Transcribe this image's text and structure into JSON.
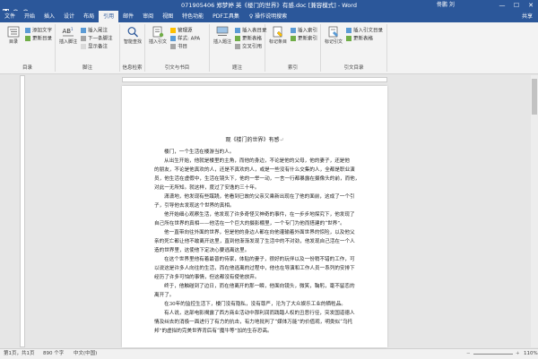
{
  "window": {
    "title": "071905406 郑梦婷 英《楼门的世界》有感.doc [兼容模式] - Word",
    "user": "佟鹏 刘",
    "controls": [
      "—",
      "☐",
      "✕"
    ]
  },
  "tabs": [
    {
      "label": "文件",
      "active": false
    },
    {
      "label": "开始",
      "active": false
    },
    {
      "label": "插入",
      "active": false
    },
    {
      "label": "设计",
      "active": false
    },
    {
      "label": "布局",
      "active": false
    },
    {
      "label": "引用",
      "active": true
    },
    {
      "label": "邮件",
      "active": false
    },
    {
      "label": "审阅",
      "active": false
    },
    {
      "label": "视图",
      "active": false
    },
    {
      "label": "特色功能",
      "active": false
    },
    {
      "label": "PDF工具集",
      "active": false
    }
  ],
  "tell_me": "♀ 操作说明搜索",
  "share": "共享",
  "ribbon": {
    "toc": {
      "big": "目录",
      "add_text": "添加文字",
      "update_table": "更新目录",
      "group": "目录"
    },
    "footnotes": {
      "insert_footnote": "插入脚注",
      "insert_endnote": "插入尾注",
      "next_footnote": "下一条脚注",
      "show_notes": "显示备注",
      "group": "脚注"
    },
    "research": {
      "smart_lookup": "智能查找",
      "group": "信息检索"
    },
    "citations": {
      "insert_citation": "插入引文",
      "manage_sources": "管理源",
      "style_label": "样式:",
      "style_value": "APA",
      "bibliography": "书目",
      "group": "引文与书目"
    },
    "captions": {
      "insert_caption": "插入题注",
      "insert_tof": "插入表目录",
      "update_table": "更新表格",
      "cross_ref": "交叉引用",
      "group": "题注"
    },
    "index": {
      "mark_entry": "标记条目",
      "insert_index": "插入索引",
      "update_index": "更新索引",
      "group": "索引"
    },
    "authorities": {
      "mark_citation": "标记引文",
      "insert_toa": "插入引文目录",
      "update_table": "更新表格",
      "group": "引文目录"
    }
  },
  "document": {
    "title": "观《楼门的世界》有感",
    "lines": [
      {
        "text": "楼门，一个生活在楼游当的人。",
        "indent": true
      },
      {
        "text": "从出生开始，他就是楼里的主角，而他的身边，不论是他的父母，他的妻子，还是他",
        "indent": true
      },
      {
        "text": "的朋友，不论是他真欢的人，还是不真欢的人，或是一些没有什么交集的人，全都是职业演",
        "indent": false
      },
      {
        "text": "员，他生活在虚假中，生活在镜头下，他的一举一动，一言一行都暴露在摄像头的前，而他，",
        "indent": false
      },
      {
        "text": "对此一无所知。就这样，度过了安逸的三十年。",
        "indent": false
      },
      {
        "text": "潇潇地，他发现有些蹊跷，他看到已故的父亲又乘新出现在了他的面前，这成了一个引",
        "indent": true
      },
      {
        "text": "子，引导他去发现这个世界的真相。",
        "indent": false
      },
      {
        "text": "他开始细心观察生活，他发现了许多奇怪又神奇的事件，在一步步地探究下，他发现了",
        "indent": true
      },
      {
        "text": "自己所在世界的真相——他活在一个巨大的摄影棚里，一个专门为他而搭建的“世界”。",
        "indent": false
      },
      {
        "text": "他一直带向往外面的世界，但是他的身边人都在向他灌输着外面世界的惊险，以及他父",
        "indent": true
      },
      {
        "text": "亲的死亡都让他不敢离开这里，直到他渐渐发现了生活中的不对劲，他发现自己活在一个人",
        "indent": false
      },
      {
        "text": "造的世界里，这使他下定决心要逃离这里。",
        "indent": false
      },
      {
        "text": "在这个世界里他有着最普的待家，体贴的妻子，很好的玩伴以及一份稍不错的工作，可",
        "indent": true
      },
      {
        "text": "以说这是许多人向往的生活，而在他逃离的过程中，他也在导演和工作人员一系列的安排下",
        "indent": false
      },
      {
        "text": "经历了许多可怕的事情，但这都没有使他放弃。",
        "indent": false
      },
      {
        "text": "终于，他触碰到了边日，而在他离开的那一瞬，他面向镜头，微笑，鞠躬，毫不留恋的",
        "indent": true
      },
      {
        "text": "离开了。",
        "indent": false
      },
      {
        "text": "在30年的监控生活下，楼门没有隐私，没有尊严，沦为了大众娱乐工业的牺牲品。",
        "indent": true
      },
      {
        "text": "有人说，这部电影揭露了西方商业活动中那利润而践踏人权的丑恶行径，突发国道德人",
        "indent": true
      },
      {
        "text": "情及纠去的消极一面进行了有力的抗击，有力地批判了“媒体万能”的价值观，明类似“乌托",
        "indent": false
      },
      {
        "text": "邦”的虚拟的完美世界背后有“魔牛等”加的生存恐高。",
        "indent": false
      }
    ]
  },
  "status": {
    "page": "第1页，共1页",
    "words": "890 个字",
    "lang": "中文(中国)",
    "zoom": "110%"
  }
}
